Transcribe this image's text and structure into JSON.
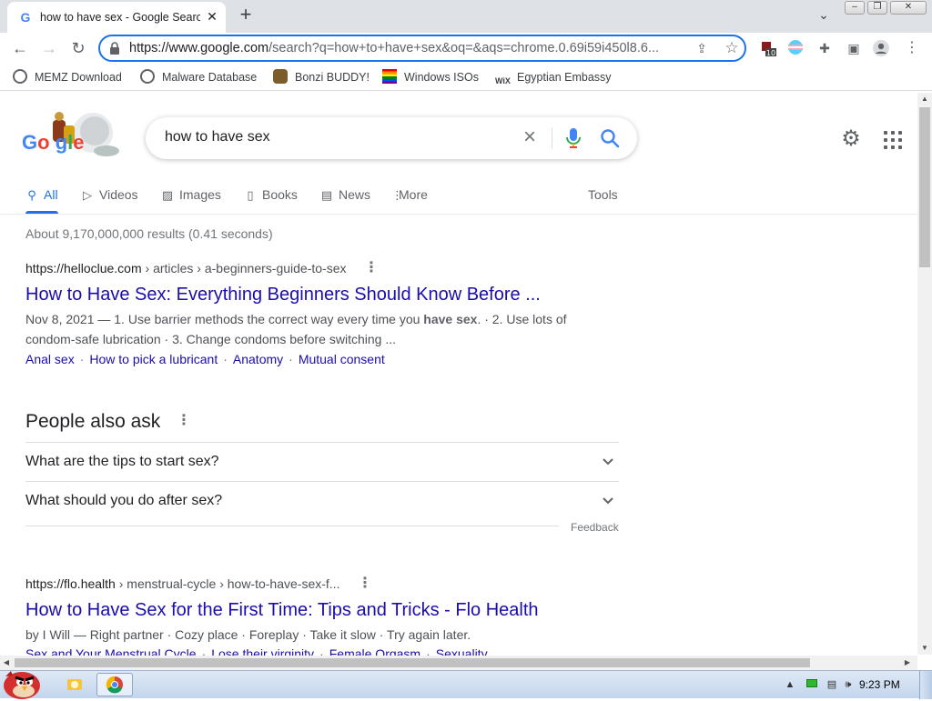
{
  "browser": {
    "tab_title": "how to have sex - Google Search",
    "tab_favicon": "G",
    "url_host": "https://www.google.com",
    "url_rest": "/search?q=how+to+have+sex&oq=&aqs=chrome.0.69i59i450l8.6...",
    "extension_badge": "10",
    "bookmarks": [
      {
        "label": "MEMZ Download",
        "icon": "globe-icon",
        "color": "#5f6368"
      },
      {
        "label": "Malware Database",
        "icon": "globe-icon",
        "color": "#5f6368"
      },
      {
        "label": "Bonzi BUDDY!",
        "icon": "bonzi-icon",
        "color": "#7b5c2a"
      },
      {
        "label": "Windows ISOs",
        "icon": "rainbow-flag-icon",
        "color": "#e53935"
      },
      {
        "label": "Egyptian Embassy",
        "icon": "wix-icon",
        "color": "#000000"
      }
    ]
  },
  "search": {
    "query": "how to have sex",
    "tabs": [
      "All",
      "Videos",
      "Images",
      "Books",
      "News",
      "More"
    ],
    "tools_label": "Tools",
    "stats": "About 9,170,000,000 results (0.41 seconds)"
  },
  "results": [
    {
      "cite_host": "https://helloclue.com",
      "cite_path": " › articles › a-beginners-guide-to-sex",
      "title": "How to Have Sex: Everything Beginners Should Know Before ...",
      "snippet_pre": "Nov 8, 2021 — 1. Use barrier methods the correct way every time you ",
      "snippet_bold": "have sex",
      "snippet_post": ". · 2. Use lots of condom-safe lubrication · 3. Change condoms before switching ...",
      "sitelinks": [
        "Anal sex",
        "How to pick a lubricant",
        "Anatomy",
        "Mutual consent"
      ]
    },
    {
      "cite_host": "https://flo.health",
      "cite_path": " › menstrual-cycle › how-to-have-sex-f...",
      "title": "How to Have Sex for the First Time: Tips and Tricks - Flo Health",
      "snippet": "by I Will — Right partner · Cozy place · Foreplay · Take it slow · Try again later.",
      "sitelinks": [
        "Sex and Your Menstrual Cycle",
        "Lose their virginity",
        "Female Orgasm",
        "Sexuality"
      ]
    }
  ],
  "people_also_ask": {
    "title": "People also ask",
    "questions": [
      "What are the tips to start sex?",
      "What should you do after sex?"
    ],
    "feedback": "Feedback"
  },
  "taskbar": {
    "clock": "9:23 PM"
  },
  "colors": {
    "link": "#1a0dab",
    "accent": "#1a73e8",
    "tabstrip": "#dee1e6"
  }
}
